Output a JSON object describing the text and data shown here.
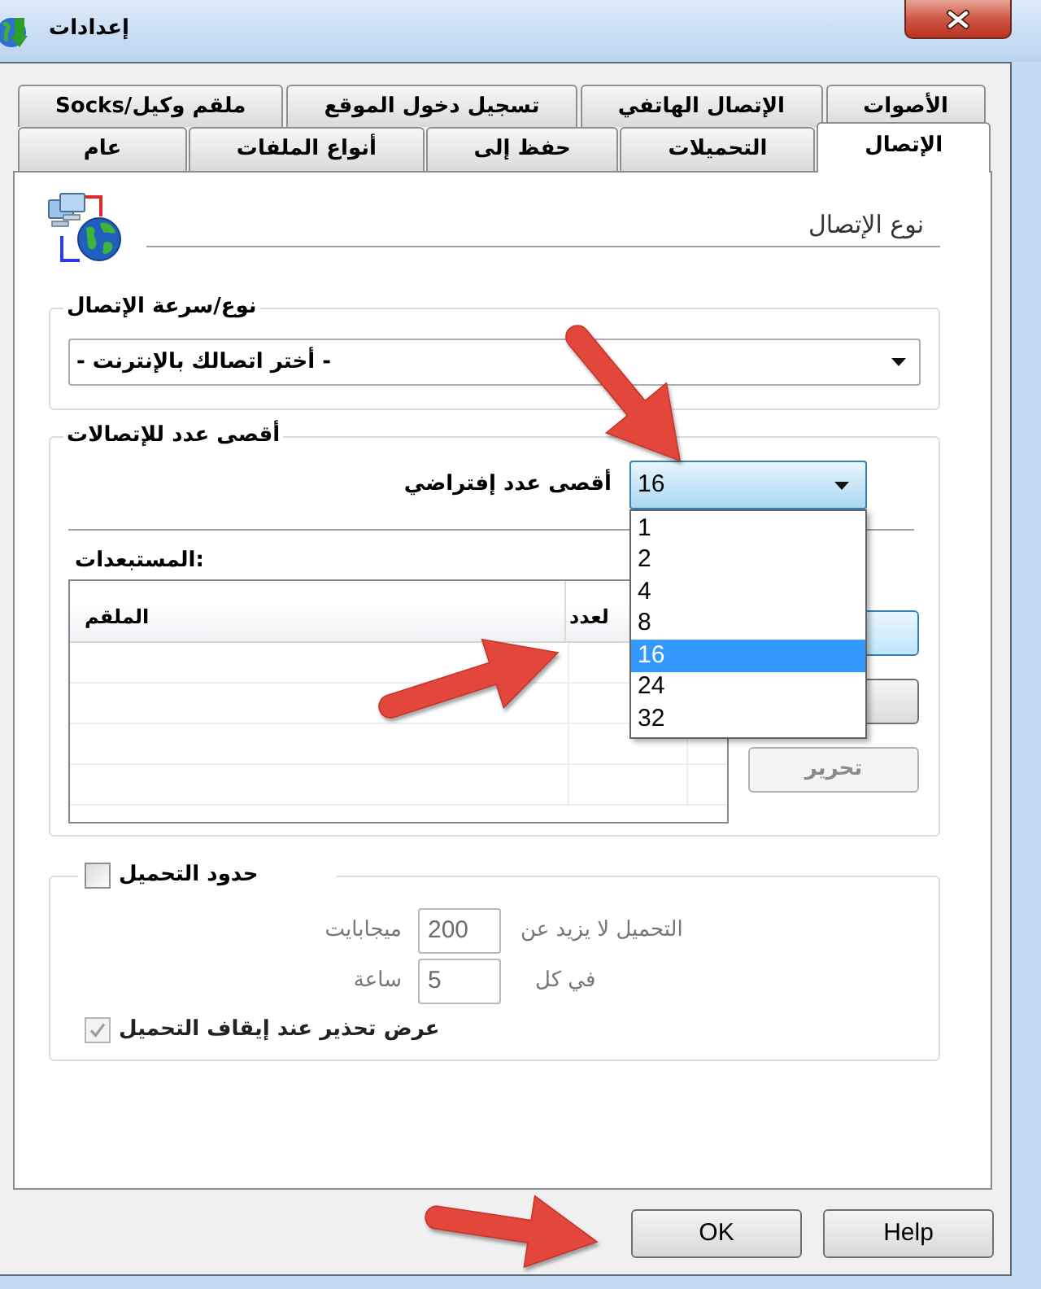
{
  "window": {
    "title": "إعدادات"
  },
  "tab_rows": [
    {
      "tabs": [
        {
          "label": "الأصوات",
          "selected": false
        },
        {
          "label": "الإتصال الهاتفي",
          "selected": false
        },
        {
          "label": "تسجيل دخول الموقع",
          "selected": false
        },
        {
          "label": "Socks/ملقم وكيل",
          "selected": false
        }
      ]
    },
    {
      "tabs": [
        {
          "label": "الإتصال",
          "selected": true
        },
        {
          "label": "التحميلات",
          "selected": false
        },
        {
          "label": "حفظ إلى",
          "selected": false
        },
        {
          "label": "أنواع الملفات",
          "selected": false
        },
        {
          "label": "عام",
          "selected": false
        }
      ]
    }
  ],
  "section": {
    "title": "نوع الإتصال"
  },
  "connection_type": {
    "legend": "نوع/سرعة الإتصال",
    "value": "- أختر اتصالك بالإنترنت -"
  },
  "max_connections": {
    "legend": "أقصى عدد للإتصالات",
    "default_label": "أقصى عدد إفتراضي",
    "default_value": "16",
    "expanded": true,
    "options": [
      {
        "label": "1",
        "selected": false
      },
      {
        "label": "2",
        "selected": false
      },
      {
        "label": "4",
        "selected": false
      },
      {
        "label": "8",
        "selected": false
      },
      {
        "label": "16",
        "selected": true
      },
      {
        "label": "24",
        "selected": false
      },
      {
        "label": "32",
        "selected": false
      }
    ],
    "excluded_label": "المستبعدات:",
    "table": {
      "columns": [
        "لعدد",
        "الملقم"
      ]
    },
    "buttons": [
      {
        "focused": true,
        "disabled": false
      },
      {
        "focused": false,
        "disabled": false
      },
      {
        "label": "تحرير",
        "focused": false,
        "disabled": true
      }
    ]
  },
  "download_limits": {
    "legend": "حدود التحميل",
    "checked": false,
    "disabled": true,
    "rows": [
      {
        "label": "التحميل لا يزيد عن",
        "value": "200",
        "unit": "ميجابايت"
      },
      {
        "label": "في كل",
        "value": "5",
        "unit": "ساعة"
      }
    ],
    "warning": {
      "label": "عرض تحذير عند إيقاف التحميل",
      "checked": true
    }
  },
  "buttons": [
    {
      "label": "Help"
    },
    {
      "label": "OK"
    }
  ]
}
